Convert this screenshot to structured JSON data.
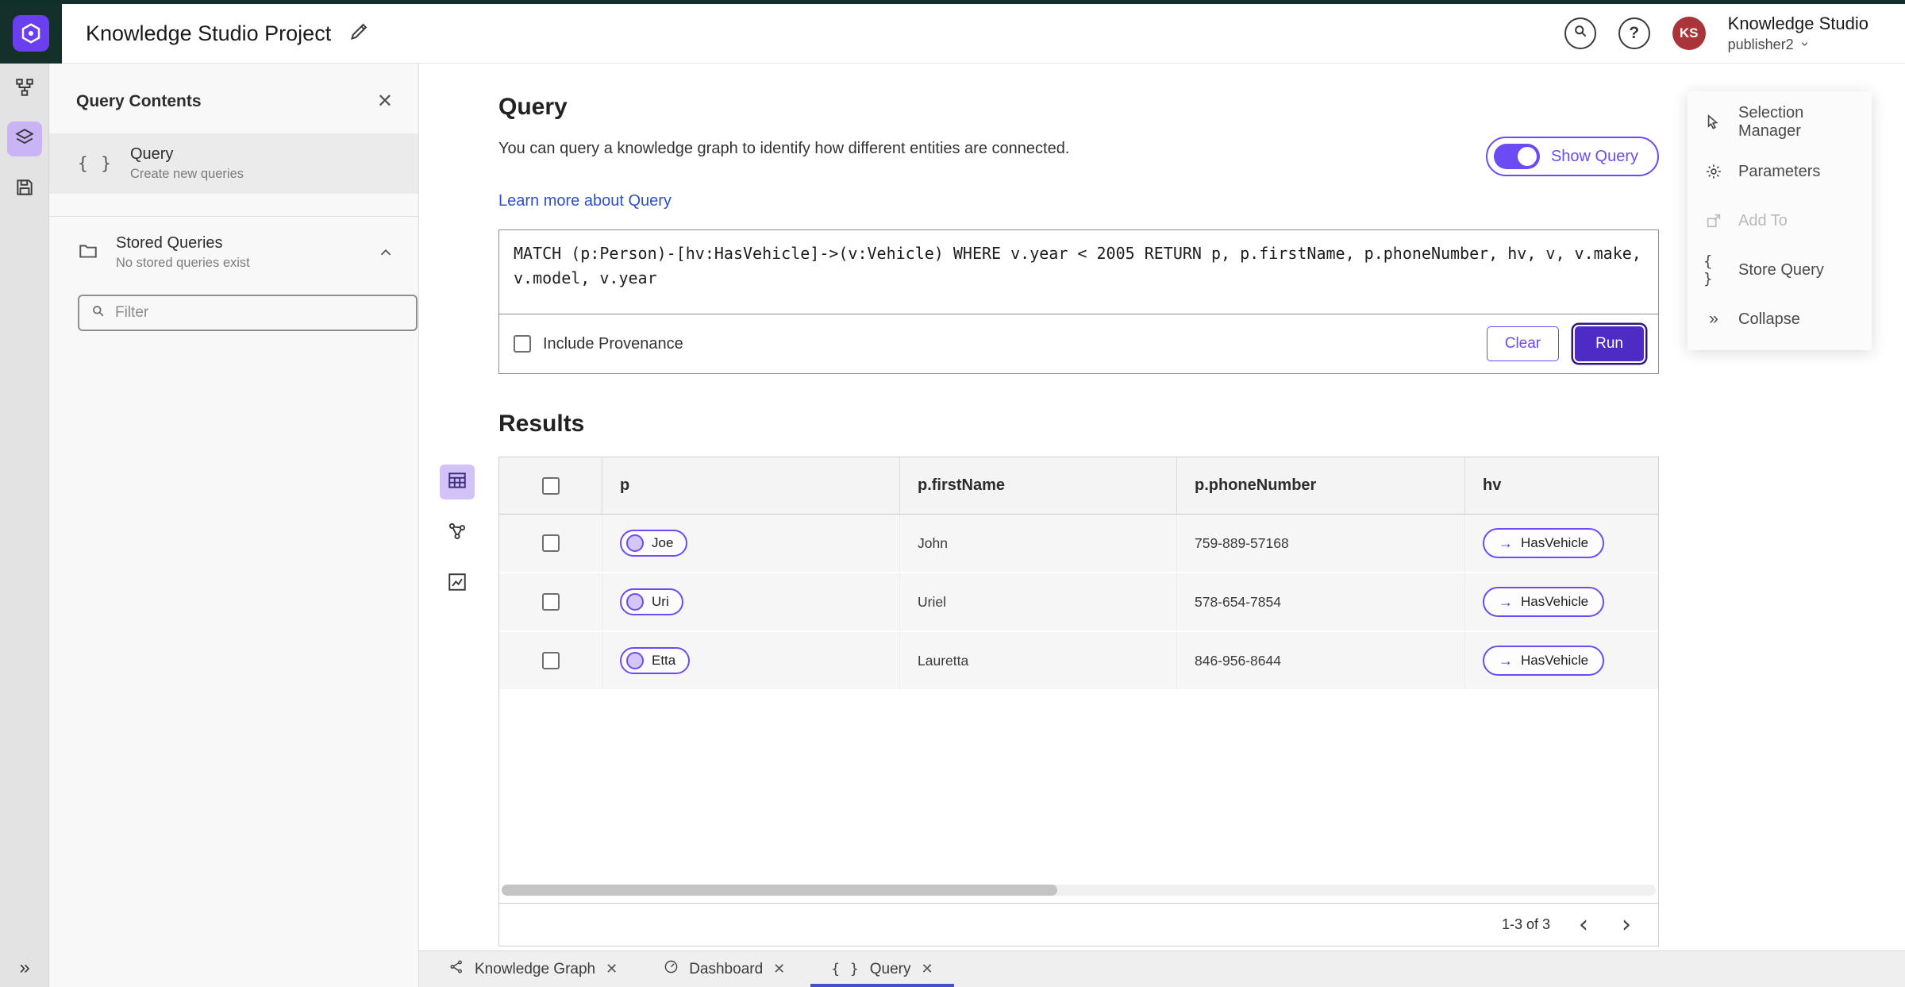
{
  "header": {
    "app_title": "Knowledge Studio Project",
    "product_name": "Knowledge Studio",
    "user_name": "publisher2",
    "avatar_initials": "KS"
  },
  "left_panel": {
    "title": "Query Contents",
    "query_item": {
      "label": "Query",
      "description": "Create new queries"
    },
    "stored_queries": {
      "label": "Stored Queries",
      "description": "No stored queries exist"
    },
    "filter_placeholder": "Filter"
  },
  "query_section": {
    "title": "Query",
    "description": "You can query a knowledge graph to identify how different entities are connected.",
    "learn_more_label": "Learn more about Query",
    "show_query_label": "Show Query",
    "query_text": "MATCH (p:Person)-[hv:HasVehicle]->(v:Vehicle) WHERE v.year < 2005 RETURN p, p.firstName, p.phoneNumber, hv, v, v.make, v.model, v.year",
    "include_provenance_label": "Include Provenance",
    "clear_label": "Clear",
    "run_label": "Run"
  },
  "results": {
    "title": "Results",
    "columns": {
      "p": "p",
      "firstName": "p.firstName",
      "phoneNumber": "p.phoneNumber",
      "hv": "hv"
    },
    "rows": [
      {
        "p": "Joe",
        "firstName": "John",
        "phoneNumber": "759-889-57168",
        "hv": "HasVehicle"
      },
      {
        "p": "Uri",
        "firstName": "Uriel",
        "phoneNumber": "578-654-7854",
        "hv": "HasVehicle"
      },
      {
        "p": "Etta",
        "firstName": "Lauretta",
        "phoneNumber": "846-956-8644",
        "hv": "HasVehicle"
      }
    ],
    "edge_arrow": "→",
    "pagination": "1-3 of 3"
  },
  "right_menu": {
    "selection_manager": "Selection Manager",
    "parameters": "Parameters",
    "add_to": "Add To",
    "store_query": "Store Query",
    "collapse": "Collapse"
  },
  "tabs": [
    {
      "label": "Knowledge Graph"
    },
    {
      "label": "Dashboard"
    },
    {
      "label": "Query"
    }
  ],
  "colors": {
    "accent": "#6C4BF4",
    "run_button": "#4D2BC4",
    "link": "#2D50C8",
    "avatar": "#A93439",
    "selected_light": "#C9B4F6"
  }
}
